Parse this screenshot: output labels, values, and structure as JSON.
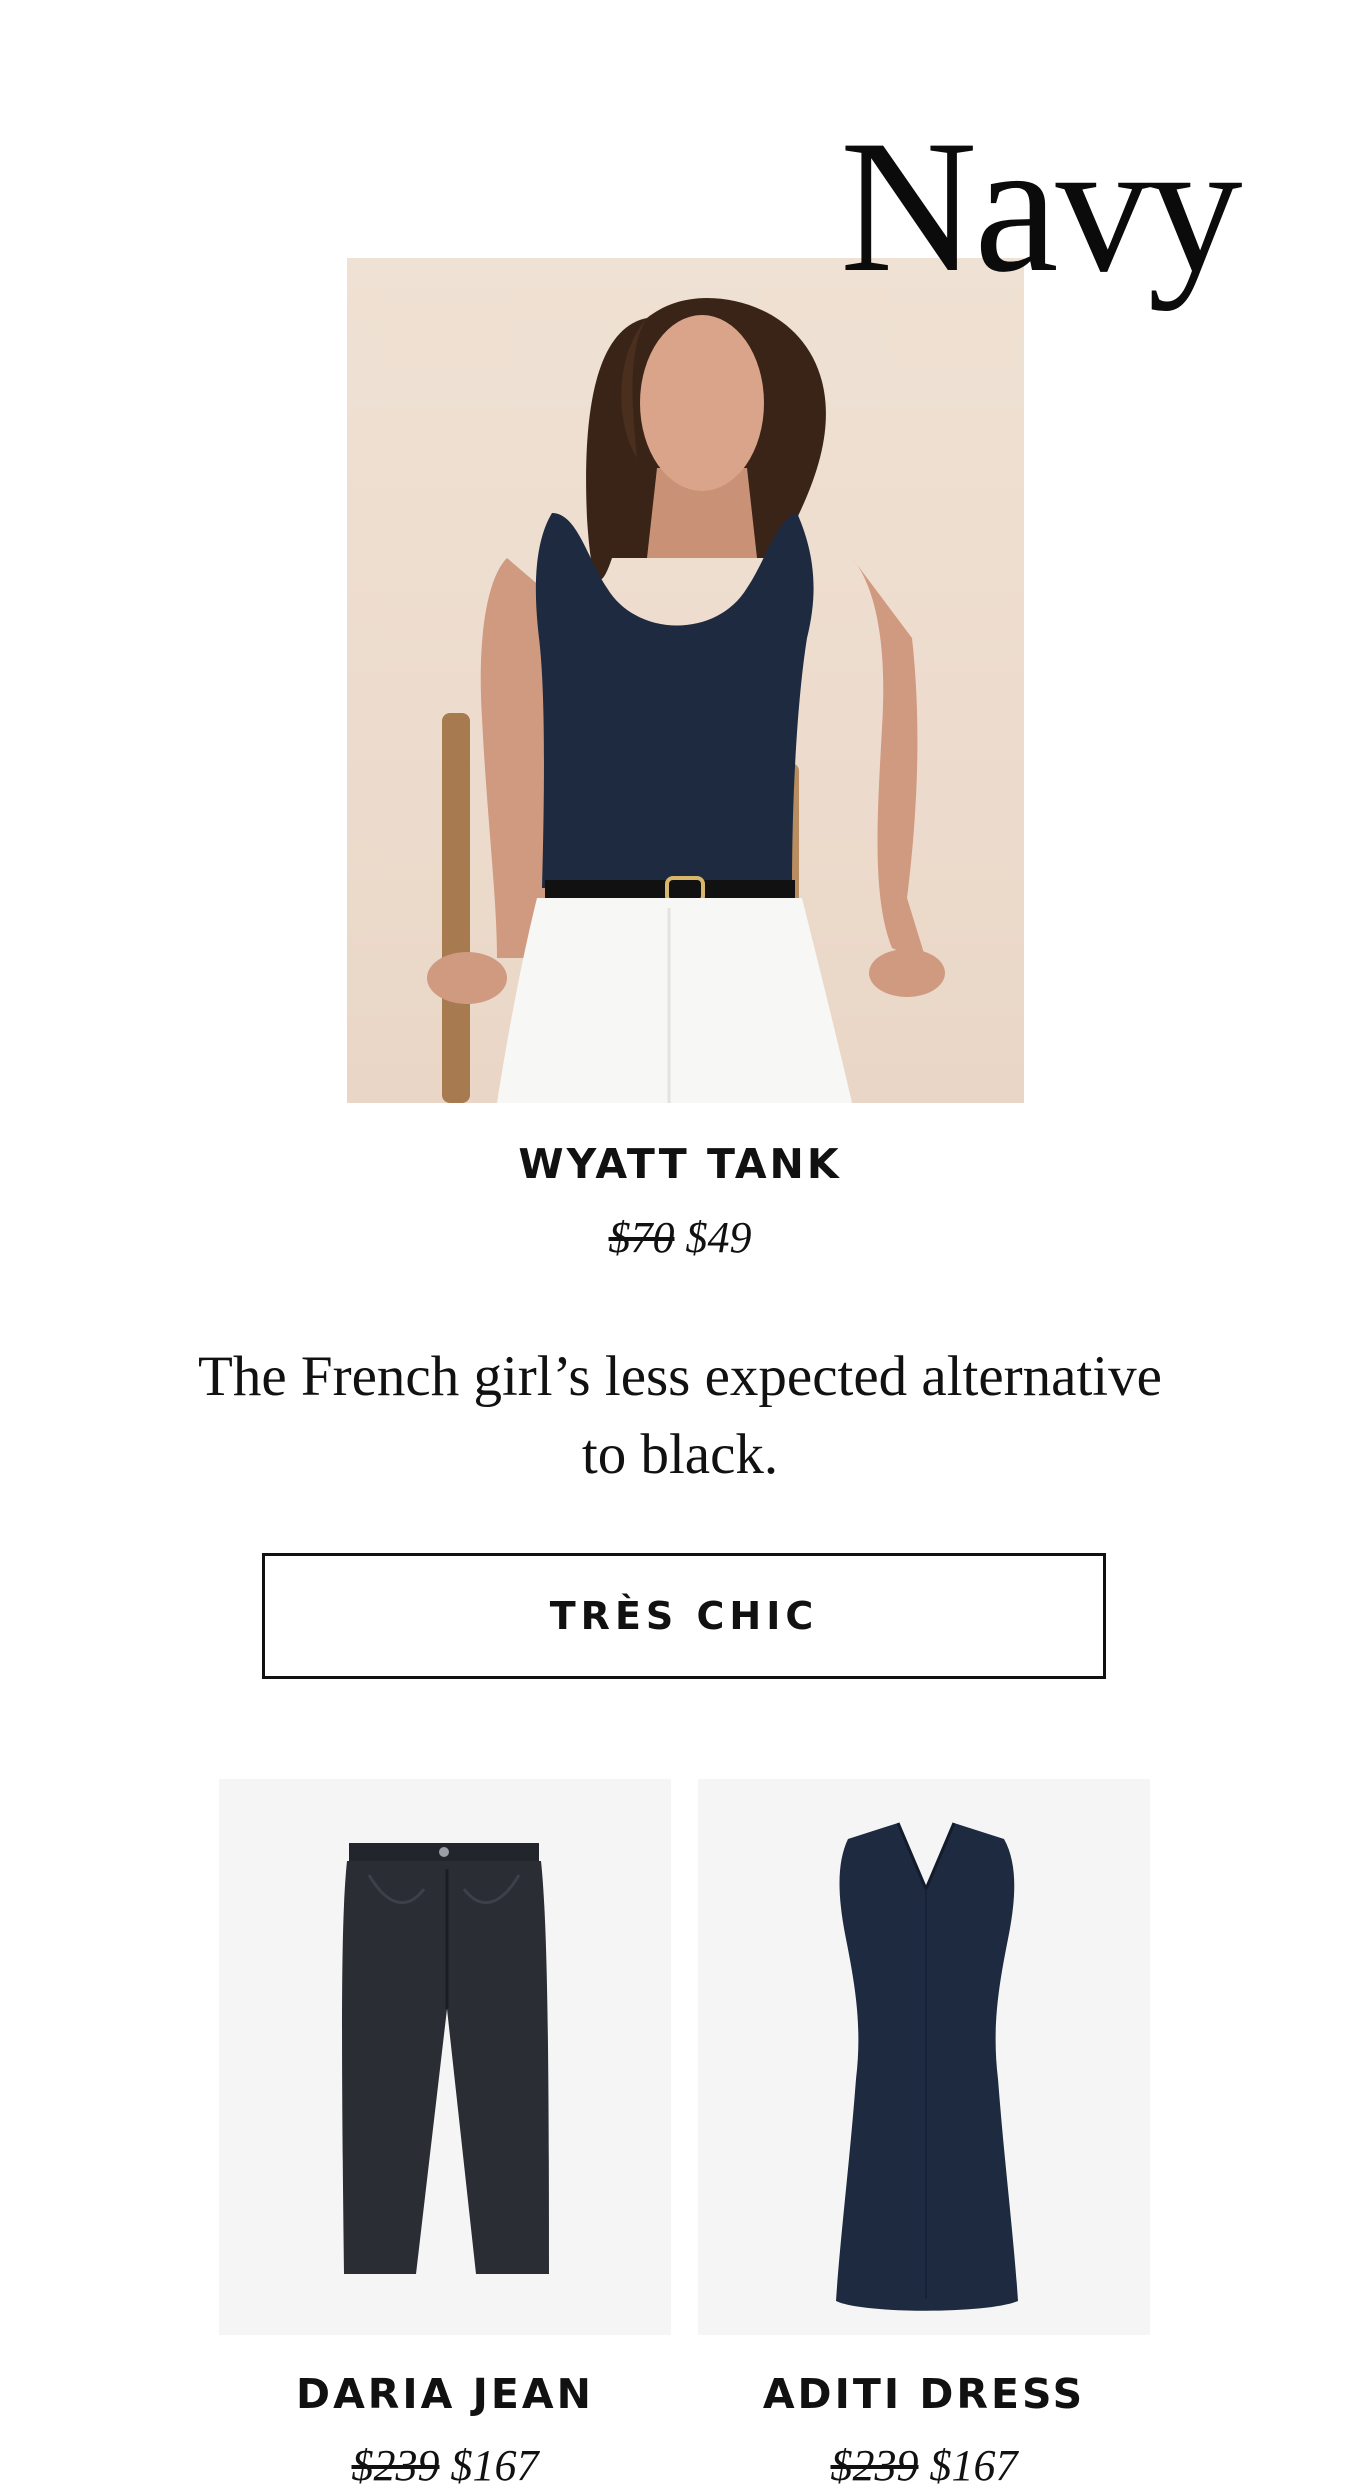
{
  "hero": {
    "title": "Navy",
    "product": {
      "name": "WYATT TANK",
      "price_original": "$70",
      "price_sale": "$49"
    }
  },
  "tagline": "The French girl’s less expected alternative to black.",
  "cta": {
    "label": "TRÈS CHIC"
  },
  "products": [
    {
      "name": "DARIA JEAN",
      "price_original": "$239",
      "price_sale": "$167"
    },
    {
      "name": "ADITI DRESS",
      "price_original": "$239",
      "price_sale": "$167"
    }
  ],
  "colors": {
    "navy": "#1d2a3f",
    "background": "#ffffff",
    "tile_background": "#f5f5f5",
    "text": "#111111"
  }
}
